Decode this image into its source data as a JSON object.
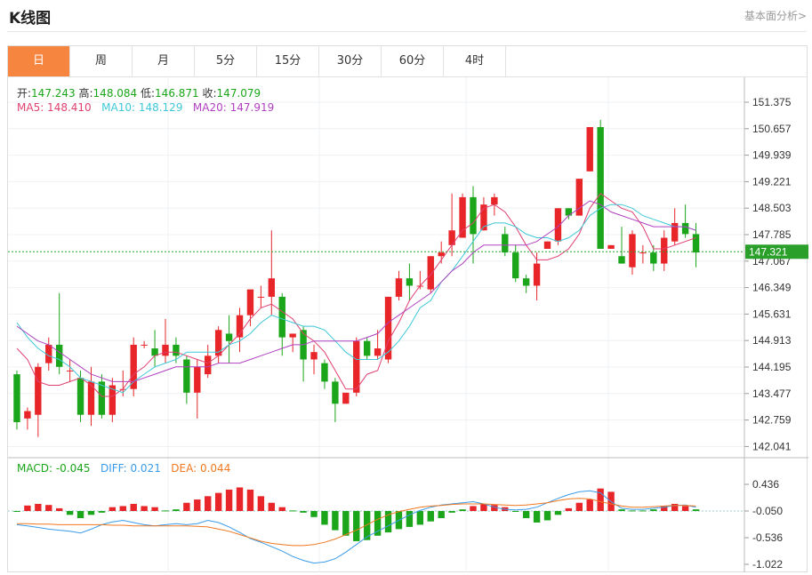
{
  "header": {
    "title": "K线图",
    "link": "基本面分析>"
  },
  "tabs": [
    {
      "label": "日",
      "active": true
    },
    {
      "label": "周",
      "active": false
    },
    {
      "label": "月",
      "active": false
    },
    {
      "label": "5分",
      "active": false
    },
    {
      "label": "15分",
      "active": false
    },
    {
      "label": "30分",
      "active": false
    },
    {
      "label": "60分",
      "active": false
    },
    {
      "label": "4时",
      "active": false
    }
  ],
  "ohlc_info": {
    "open_label": "开:",
    "open": "147.243",
    "high_label": "高:",
    "high": "148.084",
    "low_label": "低:",
    "low": "146.871",
    "close_label": "收:",
    "close": "147.079"
  },
  "ma_info": {
    "ma5": "MA5: 148.410",
    "ma10": "MA10: 148.129",
    "ma20": "MA20: 147.919"
  },
  "macd_info": {
    "macd": "MACD: -0.045",
    "diff": "DIFF: 0.021",
    "dea": "DEA: 0.044"
  },
  "current_price": "147.321",
  "colors": {
    "up": "#e8262a",
    "down": "#1aa51a",
    "ma5": "#e04070",
    "ma10": "#3ec8d8",
    "ma20": "#b040c0",
    "diff": "#3a9be8",
    "dea": "#f07820",
    "accent": "#f5853f",
    "price_line": "#2aa02a"
  },
  "chart_data": [
    {
      "type": "candlestick",
      "grid": true,
      "price_axis_ticks": [
        "151.375",
        "150.657",
        "149.939",
        "149.221",
        "148.503",
        "147.785",
        "147.067",
        "146.349",
        "145.631",
        "144.913",
        "144.195",
        "143.477",
        "142.759",
        "142.041"
      ],
      "ylim": [
        142.041,
        151.375
      ],
      "candles": [
        {
          "o": 144.0,
          "h": 144.1,
          "l": 142.5,
          "c": 142.7
        },
        {
          "o": 142.8,
          "h": 143.1,
          "l": 142.5,
          "c": 143.0
        },
        {
          "o": 142.9,
          "h": 144.3,
          "l": 142.3,
          "c": 144.2
        },
        {
          "o": 144.3,
          "h": 145.0,
          "l": 144.1,
          "c": 144.8
        },
        {
          "o": 144.8,
          "h": 146.2,
          "l": 144.0,
          "c": 144.2
        },
        {
          "o": 144.1,
          "h": 144.4,
          "l": 143.8,
          "c": 144.1
        },
        {
          "o": 143.9,
          "h": 144.1,
          "l": 142.7,
          "c": 142.9
        },
        {
          "o": 142.9,
          "h": 144.2,
          "l": 142.6,
          "c": 143.8
        },
        {
          "o": 143.8,
          "h": 144.0,
          "l": 142.8,
          "c": 142.9
        },
        {
          "o": 142.9,
          "h": 143.9,
          "l": 142.7,
          "c": 143.7
        },
        {
          "o": 143.6,
          "h": 144.1,
          "l": 143.4,
          "c": 143.6
        },
        {
          "o": 143.6,
          "h": 145.0,
          "l": 143.4,
          "c": 144.8
        },
        {
          "o": 144.8,
          "h": 144.9,
          "l": 144.7,
          "c": 144.8
        },
        {
          "o": 144.7,
          "h": 145.2,
          "l": 144.2,
          "c": 144.5
        },
        {
          "o": 144.5,
          "h": 145.5,
          "l": 144.3,
          "c": 144.8
        },
        {
          "o": 144.8,
          "h": 145.0,
          "l": 144.3,
          "c": 144.5
        },
        {
          "o": 144.4,
          "h": 144.5,
          "l": 143.2,
          "c": 143.5
        },
        {
          "o": 143.5,
          "h": 144.4,
          "l": 142.8,
          "c": 144.2
        },
        {
          "o": 144.0,
          "h": 144.8,
          "l": 143.9,
          "c": 144.5
        },
        {
          "o": 144.5,
          "h": 145.3,
          "l": 144.3,
          "c": 145.2
        },
        {
          "o": 145.1,
          "h": 145.6,
          "l": 144.3,
          "c": 144.9
        },
        {
          "o": 145.0,
          "h": 145.8,
          "l": 144.6,
          "c": 145.6
        },
        {
          "o": 145.6,
          "h": 146.2,
          "l": 145.3,
          "c": 146.3
        },
        {
          "o": 146.1,
          "h": 146.4,
          "l": 145.8,
          "c": 146.1
        },
        {
          "o": 146.1,
          "h": 147.9,
          "l": 145.6,
          "c": 146.6
        },
        {
          "o": 146.1,
          "h": 146.2,
          "l": 144.5,
          "c": 145.0
        },
        {
          "o": 145.0,
          "h": 145.1,
          "l": 144.6,
          "c": 145.1
        },
        {
          "o": 145.2,
          "h": 145.3,
          "l": 143.8,
          "c": 144.4
        },
        {
          "o": 144.4,
          "h": 144.8,
          "l": 144.0,
          "c": 144.6
        },
        {
          "o": 144.3,
          "h": 144.4,
          "l": 143.6,
          "c": 143.8
        },
        {
          "o": 143.8,
          "h": 143.9,
          "l": 142.7,
          "c": 143.2
        },
        {
          "o": 143.2,
          "h": 143.4,
          "l": 143.2,
          "c": 143.5
        },
        {
          "o": 143.5,
          "h": 145.0,
          "l": 143.4,
          "c": 144.9
        },
        {
          "o": 144.9,
          "h": 145.0,
          "l": 144.4,
          "c": 144.5
        },
        {
          "o": 144.5,
          "h": 145.2,
          "l": 144.4,
          "c": 144.7
        },
        {
          "o": 144.4,
          "h": 145.2,
          "l": 144.3,
          "c": 146.1
        },
        {
          "o": 146.1,
          "h": 146.8,
          "l": 146.0,
          "c": 146.6
        },
        {
          "o": 146.6,
          "h": 147.0,
          "l": 146.0,
          "c": 146.4
        },
        {
          "o": 146.4,
          "h": 146.8,
          "l": 146.3,
          "c": 146.4
        },
        {
          "o": 146.3,
          "h": 147.2,
          "l": 146.2,
          "c": 147.2
        },
        {
          "o": 147.2,
          "h": 147.6,
          "l": 147.0,
          "c": 147.3
        },
        {
          "o": 147.5,
          "h": 148.9,
          "l": 147.2,
          "c": 147.9
        },
        {
          "o": 147.7,
          "h": 148.9,
          "l": 147.7,
          "c": 148.8
        },
        {
          "o": 148.8,
          "h": 149.1,
          "l": 147.0,
          "c": 147.8
        },
        {
          "o": 147.9,
          "h": 148.8,
          "l": 147.9,
          "c": 148.6
        },
        {
          "o": 148.6,
          "h": 148.9,
          "l": 148.3,
          "c": 148.8
        },
        {
          "o": 147.8,
          "h": 148.0,
          "l": 147.2,
          "c": 147.3
        },
        {
          "o": 147.3,
          "h": 147.5,
          "l": 146.5,
          "c": 146.6
        },
        {
          "o": 146.6,
          "h": 146.7,
          "l": 146.2,
          "c": 146.4
        },
        {
          "o": 146.4,
          "h": 147.3,
          "l": 146.0,
          "c": 147.0
        },
        {
          "o": 147.4,
          "h": 147.6,
          "l": 147.4,
          "c": 147.6
        },
        {
          "o": 147.6,
          "h": 148.5,
          "l": 147.5,
          "c": 148.5
        },
        {
          "o": 148.5,
          "h": 148.5,
          "l": 148.2,
          "c": 148.3
        },
        {
          "o": 148.3,
          "h": 149.2,
          "l": 148.3,
          "c": 149.3
        },
        {
          "o": 149.5,
          "h": 150.6,
          "l": 149.5,
          "c": 150.7
        },
        {
          "o": 150.7,
          "h": 150.9,
          "l": 147.4,
          "c": 147.4
        },
        {
          "o": 147.4,
          "h": 147.5,
          "l": 147.4,
          "c": 147.5
        },
        {
          "o": 147.2,
          "h": 148.0,
          "l": 147.0,
          "c": 147.0
        },
        {
          "o": 146.9,
          "h": 147.9,
          "l": 146.7,
          "c": 147.8
        },
        {
          "o": 147.3,
          "h": 147.5,
          "l": 147.0,
          "c": 147.3
        },
        {
          "o": 147.3,
          "h": 147.5,
          "l": 146.8,
          "c": 147.0
        },
        {
          "o": 147.0,
          "h": 147.9,
          "l": 146.8,
          "c": 147.7
        },
        {
          "o": 147.6,
          "h": 148.5,
          "l": 147.5,
          "c": 148.1
        },
        {
          "o": 148.1,
          "h": 148.6,
          "l": 147.7,
          "c": 147.8
        },
        {
          "o": 147.8,
          "h": 148.1,
          "l": 146.9,
          "c": 147.3
        }
      ],
      "ma5": [
        144.7,
        144.4,
        143.8,
        143.7,
        143.7,
        143.8,
        143.9,
        143.7,
        143.4,
        143.4,
        143.6,
        144.0,
        144.2,
        144.5,
        144.6,
        144.6,
        144.5,
        144.4,
        144.3,
        144.5,
        144.8,
        145.1,
        145.5,
        145.8,
        145.9,
        145.7,
        145.5,
        145.1,
        144.9,
        144.6,
        144.1,
        143.6,
        143.6,
        144.0,
        144.1,
        144.9,
        145.4,
        146.0,
        146.4,
        146.7,
        147.1,
        147.5,
        147.9,
        148.1,
        148.5,
        148.6,
        148.4,
        148.0,
        147.5,
        147.1,
        147.1,
        147.2,
        147.4,
        147.8,
        148.5,
        148.9,
        148.7,
        148.5,
        148.4,
        148.0,
        147.4,
        147.4,
        147.5,
        147.6,
        147.7
      ],
      "ma10": [
        145.4,
        145.0,
        144.7,
        144.5,
        144.4,
        144.2,
        143.9,
        143.8,
        143.7,
        143.6,
        143.5,
        143.8,
        144.0,
        144.2,
        144.3,
        144.4,
        144.6,
        144.6,
        144.6,
        144.6,
        144.8,
        144.9,
        145.1,
        145.4,
        145.6,
        145.5,
        145.4,
        145.3,
        145.3,
        145.2,
        144.9,
        144.6,
        144.4,
        144.4,
        144.4,
        144.6,
        144.9,
        145.3,
        145.8,
        146.0,
        146.5,
        146.8,
        147.2,
        147.6,
        148.0,
        148.1,
        148.1,
        148.0,
        147.8,
        147.7,
        147.7,
        147.6,
        147.7,
        147.9,
        148.3,
        148.5,
        148.6,
        148.6,
        148.5,
        148.3,
        148.2,
        148.1,
        148.0,
        148.0,
        147.9
      ],
      "ma20": [
        145.3,
        145.1,
        144.9,
        144.8,
        144.6,
        144.4,
        144.2,
        144.0,
        143.9,
        143.8,
        143.8,
        143.8,
        143.9,
        144.0,
        144.1,
        144.2,
        144.2,
        144.2,
        144.2,
        144.3,
        144.3,
        144.3,
        144.4,
        144.5,
        144.6,
        144.7,
        144.8,
        144.8,
        144.9,
        144.9,
        144.9,
        144.9,
        144.9,
        145.0,
        145.1,
        145.4,
        145.6,
        145.8,
        146.0,
        146.2,
        146.5,
        146.8,
        147.0,
        147.3,
        147.5,
        147.5,
        147.5,
        147.5,
        147.5,
        147.6,
        147.8,
        148.0,
        148.3,
        148.5,
        148.7,
        148.6,
        148.4,
        148.3,
        148.2,
        148.1,
        148.0,
        148.0,
        148.0,
        148.0,
        147.9
      ]
    },
    {
      "type": "bar",
      "title": "MACD",
      "macd_axis_ticks": [
        "0.436",
        "-0.050",
        "-0.536",
        "-1.022"
      ],
      "ylim": [
        -1.022,
        0.436
      ],
      "macd": [
        -0.05,
        0.05,
        0.08,
        0.06,
        0.0,
        -0.12,
        -0.18,
        -0.12,
        -0.08,
        0.02,
        0.04,
        0.08,
        0.04,
        0.02,
        -0.04,
        -0.02,
        0.1,
        0.16,
        0.22,
        0.28,
        0.34,
        0.38,
        0.34,
        0.22,
        0.1,
        0.02,
        -0.04,
        -0.08,
        -0.16,
        -0.3,
        -0.4,
        -0.5,
        -0.6,
        -0.58,
        -0.5,
        -0.44,
        -0.38,
        -0.34,
        -0.3,
        -0.24,
        -0.18,
        -0.08,
        -0.02,
        0.04,
        0.08,
        0.06,
        0.02,
        -0.06,
        -0.18,
        -0.26,
        -0.22,
        -0.12,
        0.0,
        0.1,
        0.16,
        0.36,
        0.3,
        -0.02,
        -0.04,
        -0.04,
        -0.02,
        0.04,
        0.08,
        0.04,
        -0.02
      ],
      "diff": [
        -0.3,
        -0.32,
        -0.35,
        -0.38,
        -0.4,
        -0.42,
        -0.45,
        -0.38,
        -0.3,
        -0.25,
        -0.22,
        -0.26,
        -0.3,
        -0.32,
        -0.3,
        -0.28,
        -0.3,
        -0.28,
        -0.22,
        -0.26,
        -0.34,
        -0.44,
        -0.55,
        -0.62,
        -0.7,
        -0.78,
        -0.88,
        -0.95,
        -1.0,
        -0.98,
        -0.92,
        -0.8,
        -0.66,
        -0.52,
        -0.42,
        -0.32,
        -0.22,
        -0.12,
        -0.04,
        0.02,
        0.06,
        0.08,
        0.1,
        0.12,
        0.08,
        0.02,
        -0.02,
        -0.03,
        -0.02,
        0.02,
        0.1,
        0.18,
        0.25,
        0.3,
        0.32,
        0.28,
        0.12,
        0.0,
        -0.02,
        -0.02,
        0.0,
        0.02,
        0.05,
        0.06,
        0.02
      ],
      "dea": [
        -0.28,
        -0.28,
        -0.29,
        -0.29,
        -0.3,
        -0.3,
        -0.3,
        -0.3,
        -0.3,
        -0.31,
        -0.31,
        -0.32,
        -0.32,
        -0.32,
        -0.32,
        -0.32,
        -0.32,
        -0.33,
        -0.34,
        -0.38,
        -0.42,
        -0.48,
        -0.54,
        -0.6,
        -0.64,
        -0.66,
        -0.68,
        -0.68,
        -0.66,
        -0.62,
        -0.56,
        -0.48,
        -0.4,
        -0.3,
        -0.2,
        -0.12,
        -0.06,
        -0.02,
        0.02,
        0.04,
        0.05,
        0.07,
        0.08,
        0.08,
        0.08,
        0.07,
        0.06,
        0.05,
        0.06,
        0.08,
        0.1,
        0.14,
        0.17,
        0.18,
        0.17,
        0.12,
        0.08,
        0.04,
        0.02,
        0.02,
        0.03,
        0.04,
        0.05,
        0.05,
        0.04
      ]
    }
  ]
}
